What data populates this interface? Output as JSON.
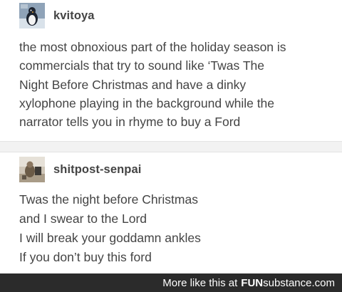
{
  "posts": [
    {
      "username": "kvitoya",
      "body_lines": [
        "the most obnoxious part of the holiday season is",
        "commercials that try to sound like ‘Twas The",
        "Night Before Christmas and have a dinky",
        "xylophone playing in the background while the",
        "narrator tells you in rhyme to buy a Ford"
      ]
    },
    {
      "username": "shitpost-senpai",
      "body_lines": [
        "Twas the night before Christmas",
        "and I swear to the Lord",
        "I will break your goddamn ankles",
        "If you don’t buy this ford"
      ]
    }
  ],
  "footer": {
    "text": "More like this at",
    "logo_bold": "FUN",
    "logo_rest": "substance.com"
  },
  "colors": {
    "text": "#444444",
    "divider": "#f2f2f2",
    "footer_bg": "#2b2b2b"
  },
  "icons": {
    "avatar_1": "avatar-penguin-icon",
    "avatar_2": "avatar-photo-icon"
  }
}
